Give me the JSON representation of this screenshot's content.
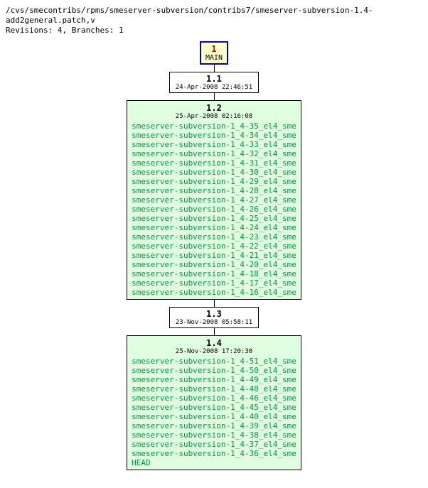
{
  "header": {
    "path": "/cvs/smecontribs/rpms/smeserver-subversion/contribs7/smeserver-subversion-1.4-add2general.patch,v",
    "stats": "Revisions: 4, Branches: 1"
  },
  "main_branch": {
    "num": "1",
    "label": "MAIN"
  },
  "nodes": [
    {
      "rev": "1.1",
      "date": "24-Apr-2008 22:46:51",
      "tags": []
    },
    {
      "rev": "1.2",
      "date": "25-Apr-2008 02:16:08",
      "tags": [
        "smeserver-subversion-1_4-35_el4_sme",
        "smeserver-subversion-1_4-34_el4_sme",
        "smeserver-subversion-1_4-33_el4_sme",
        "smeserver-subversion-1_4-32_el4_sme",
        "smeserver-subversion-1_4-31_el4_sme",
        "smeserver-subversion-1_4-30_el4_sme",
        "smeserver-subversion-1_4-29_el4_sme",
        "smeserver-subversion-1_4-28_el4_sme",
        "smeserver-subversion-1_4-27_el4_sme",
        "smeserver-subversion-1_4-26_el4_sme",
        "smeserver-subversion-1_4-25_el4_sme",
        "smeserver-subversion-1_4-24_el4_sme",
        "smeserver-subversion-1_4-23_el4_sme",
        "smeserver-subversion-1_4-22_el4_sme",
        "smeserver-subversion-1_4-21_el4_sme",
        "smeserver-subversion-1_4-20_el4_sme",
        "smeserver-subversion-1_4-18_el4_sme",
        "smeserver-subversion-1_4-17_el4_sme",
        "smeserver-subversion-1_4-16_el4_sme"
      ]
    },
    {
      "rev": "1.3",
      "date": "23-Nov-2008 05:58:11",
      "tags": []
    },
    {
      "rev": "1.4",
      "date": "25-Nov-2008 17:20:30",
      "tags": [
        "smeserver-subversion-1_4-51_el4_sme",
        "smeserver-subversion-1_4-50_el4_sme",
        "smeserver-subversion-1_4-49_el4_sme",
        "smeserver-subversion-1_4-48_el4_sme",
        "smeserver-subversion-1_4-46_el4_sme",
        "smeserver-subversion-1_4-45_el4_sme",
        "smeserver-subversion-1_4-40_el4_sme",
        "smeserver-subversion-1_4-39_el4_sme",
        "smeserver-subversion-1_4-38_el4_sme",
        "smeserver-subversion-1_4-37_el4_sme",
        "smeserver-subversion-1_4-36_el4_sme",
        "HEAD"
      ]
    }
  ]
}
